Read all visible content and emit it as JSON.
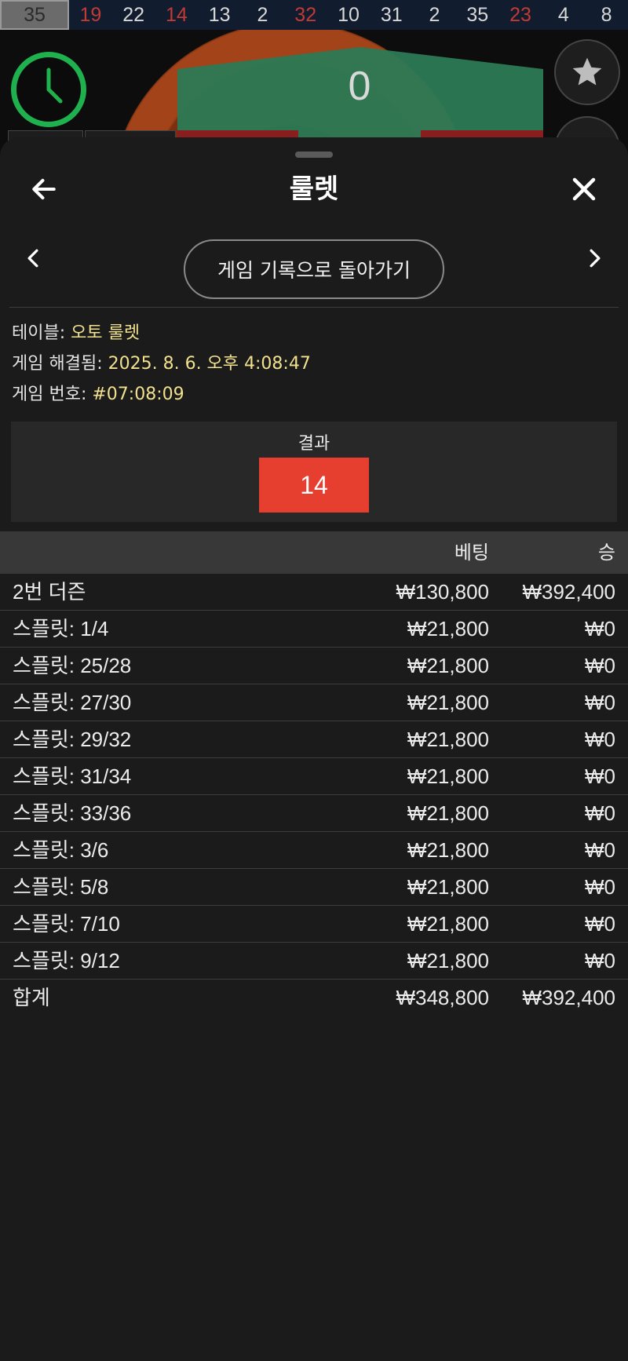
{
  "history": {
    "items": [
      {
        "value": "35",
        "color": "highlight"
      },
      {
        "value": "19",
        "color": "red"
      },
      {
        "value": "22",
        "color": "white"
      },
      {
        "value": "14",
        "color": "red"
      },
      {
        "value": "13",
        "color": "white"
      },
      {
        "value": "2",
        "color": "white"
      },
      {
        "value": "32",
        "color": "red"
      },
      {
        "value": "10",
        "color": "white"
      },
      {
        "value": "31",
        "color": "white"
      },
      {
        "value": "2",
        "color": "white"
      },
      {
        "value": "35",
        "color": "white"
      },
      {
        "value": "23",
        "color": "red"
      },
      {
        "value": "4",
        "color": "white"
      },
      {
        "value": "8",
        "color": "white"
      }
    ]
  },
  "game": {
    "zero_label": "0",
    "icons": {
      "timer": "clock-icon",
      "favorite": "star-icon"
    }
  },
  "sheet": {
    "title": "룰렛",
    "back_icon": "arrow-left-icon",
    "close_icon": "close-icon",
    "nav_label": "게임 기록으로 돌아가기",
    "prev_icon": "chevron-left-icon",
    "next_icon": "chevron-right-icon"
  },
  "info": {
    "table_label": "테이블: ",
    "table_value": "오토 룰렛",
    "resolved_label": "게임 해결됨: ",
    "resolved_value": "2025. 8. 6. 오후 4:08:47",
    "number_label": "게임 번호: ",
    "number_value": "#07:08:09"
  },
  "result": {
    "title": "결과",
    "number": "14",
    "color": "#e63f2f"
  },
  "bets": {
    "headers": {
      "bet": "베팅",
      "win": "승"
    },
    "rows": [
      {
        "name": "2번 더즌",
        "bet": "₩130,800",
        "win": "₩392,400"
      },
      {
        "name": "스플릿: 1/4",
        "bet": "₩21,800",
        "win": "₩0"
      },
      {
        "name": "스플릿: 25/28",
        "bet": "₩21,800",
        "win": "₩0"
      },
      {
        "name": "스플릿: 27/30",
        "bet": "₩21,800",
        "win": "₩0"
      },
      {
        "name": "스플릿: 29/32",
        "bet": "₩21,800",
        "win": "₩0"
      },
      {
        "name": "스플릿: 31/34",
        "bet": "₩21,800",
        "win": "₩0"
      },
      {
        "name": "스플릿: 33/36",
        "bet": "₩21,800",
        "win": "₩0"
      },
      {
        "name": "스플릿: 3/6",
        "bet": "₩21,800",
        "win": "₩0"
      },
      {
        "name": "스플릿: 5/8",
        "bet": "₩21,800",
        "win": "₩0"
      },
      {
        "name": "스플릿: 7/10",
        "bet": "₩21,800",
        "win": "₩0"
      },
      {
        "name": "스플릿: 9/12",
        "bet": "₩21,800",
        "win": "₩0"
      }
    ],
    "total": {
      "name": "합계",
      "bet": "₩348,800",
      "win": "₩392,400"
    }
  },
  "colors": {
    "accent_red": "#e63f2f",
    "info_value": "#f1e08e",
    "timer_green": "#1fb14d"
  }
}
